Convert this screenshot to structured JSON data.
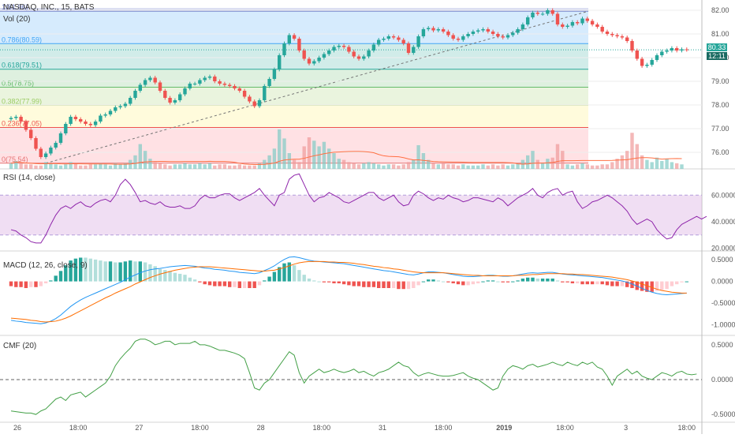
{
  "header": {
    "symbol": "NASDAQ, INC., 15, BATS",
    "volume_label": "Vol (20)",
    "rsi_label": "RSI (14, close)",
    "macd_label": "MACD (12, 26, close, 9)",
    "cmf_label": "CMF (20)"
  },
  "price_tags": {
    "last": "80.33",
    "countdown": "12:11"
  },
  "colors": {
    "up": "#26a69a",
    "down": "#ef5350",
    "rsi": "#8e24aa",
    "macd": "#2196f3",
    "signal": "#ff6d00",
    "cmf": "#43a047"
  },
  "chart_data": [
    {
      "type": "candlestick",
      "title": "NASDAQ, INC., 15, BATS",
      "ylim": [
        75.3,
        82.1
      ],
      "y_ticks": [
        "82.00",
        "81.00",
        "80.00",
        "79.00",
        "78.00",
        "77.00",
        "76.00"
      ],
      "x_ticks": [
        "26",
        "18:00",
        "27",
        "18:00",
        "28",
        "18:00",
        "31",
        "18:00",
        "2019",
        "18:00",
        "3",
        "18:00"
      ],
      "fib_levels": [
        {
          "label": "0(75.54)",
          "value": 75.54
        },
        {
          "label": "0.236(77.05)",
          "value": 77.05
        },
        {
          "label": "0.382(77.99)",
          "value": 77.99
        },
        {
          "label": "0.5(78.75)",
          "value": 78.75
        },
        {
          "label": "0.618(79.51)",
          "value": 79.51
        },
        {
          "label": "0.786(80.59)",
          "value": 80.59
        },
        {
          "label": "1(81.96)",
          "value": 81.96
        }
      ],
      "close": [
        77.45,
        77.5,
        77.3,
        76.95,
        76.6,
        76.15,
        75.8,
        75.95,
        76.2,
        76.4,
        76.8,
        77.2,
        77.5,
        77.4,
        77.3,
        77.2,
        77.15,
        77.3,
        77.55,
        77.6,
        77.75,
        77.9,
        77.95,
        78.05,
        78.3,
        78.6,
        78.85,
        79.05,
        79.15,
        78.95,
        78.6,
        78.3,
        78.1,
        78.2,
        78.45,
        78.7,
        78.9,
        78.9,
        79.05,
        79.15,
        79.2,
        79.0,
        78.9,
        78.85,
        78.8,
        78.7,
        78.6,
        78.35,
        78.15,
        77.95,
        78.2,
        78.8,
        79.1,
        79.5,
        80.1,
        80.6,
        80.95,
        80.8,
        80.3,
        79.95,
        79.75,
        79.85,
        80.0,
        80.15,
        80.3,
        80.45,
        80.5,
        80.45,
        80.25,
        80.05,
        79.95,
        80.05,
        80.3,
        80.55,
        80.75,
        80.8,
        80.9,
        80.85,
        80.75,
        80.6,
        80.2,
        80.45,
        80.9,
        81.2,
        81.25,
        81.15,
        81.2,
        81.1,
        80.95,
        80.8,
        80.75,
        80.9,
        81.0,
        81.1,
        81.15,
        81.2,
        81.1,
        81.0,
        80.9,
        80.85,
        80.95,
        81.05,
        81.2,
        81.4,
        81.7,
        81.9,
        81.85,
        81.85,
        82.0,
        81.85,
        81.4,
        81.3,
        81.35,
        81.5,
        81.45,
        81.65,
        81.55,
        81.4,
        81.3,
        81.1,
        81.0,
        80.95,
        80.9,
        80.85,
        80.7,
        80.3,
        79.95,
        79.65,
        79.7,
        79.9,
        80.1,
        80.25,
        80.3,
        80.4,
        80.3,
        80.35,
        80.33
      ]
    },
    {
      "type": "bar",
      "title": "Vol (20)",
      "values": [
        5,
        7,
        5,
        4,
        4,
        3,
        3,
        6,
        5,
        4,
        3,
        4,
        6,
        5,
        3,
        3,
        4,
        4,
        5,
        4,
        3,
        5,
        4,
        5,
        8,
        12,
        22,
        16,
        9,
        6,
        5,
        4,
        3,
        4,
        4,
        5,
        4,
        4,
        5,
        4,
        5,
        3,
        4,
        4,
        3,
        3,
        4,
        3,
        3,
        3,
        5,
        8,
        12,
        18,
        35,
        27,
        14,
        8,
        6,
        20,
        28,
        25,
        20,
        24,
        18,
        14,
        9,
        8,
        6,
        5,
        4,
        5,
        6,
        5,
        4,
        3,
        4,
        4,
        3,
        4,
        6,
        8,
        21,
        14,
        8,
        5,
        4,
        5,
        4,
        4,
        3,
        4,
        3,
        3,
        3,
        4,
        3,
        4,
        3,
        4,
        3,
        4,
        5,
        8,
        12,
        16,
        8,
        5,
        9,
        10,
        22,
        16,
        4,
        3,
        4,
        5,
        4,
        3,
        3,
        4,
        4,
        6,
        9,
        12,
        16,
        32,
        22,
        12,
        8,
        6,
        10,
        7,
        9,
        6,
        5,
        4
      ]
    },
    {
      "type": "line",
      "title": "RSI (14, close)",
      "ylim": [
        18,
        78
      ],
      "y_ticks": [
        "60.0000",
        "40.0000",
        "20.0000"
      ],
      "band": [
        30,
        60
      ],
      "values": [
        34,
        33,
        30,
        28,
        25,
        24,
        24,
        30,
        38,
        45,
        50,
        52,
        50,
        53,
        55,
        52,
        51,
        54,
        56,
        57,
        55,
        60,
        68,
        72,
        68,
        62,
        55,
        56,
        54,
        53,
        55,
        52,
        51,
        51,
        52,
        50,
        50,
        52,
        57,
        60,
        58,
        58,
        60,
        61,
        61,
        58,
        56,
        58,
        60,
        62,
        65,
        60,
        56,
        52,
        60,
        62,
        72,
        75,
        76,
        68,
        60,
        55,
        58,
        59,
        62,
        60,
        58,
        55,
        54,
        56,
        58,
        60,
        62,
        62,
        58,
        56,
        58,
        60,
        55,
        52,
        53,
        60,
        63,
        61,
        58,
        56,
        58,
        57,
        60,
        58,
        57,
        55,
        56,
        58,
        58,
        57,
        56,
        55,
        58,
        56,
        52,
        55,
        58,
        60,
        62,
        65,
        60,
        58,
        62,
        64,
        65,
        60,
        62,
        63,
        55,
        50,
        52,
        55,
        56,
        58,
        60,
        58,
        55,
        52,
        48,
        42,
        38,
        40,
        42,
        40,
        34,
        30,
        27,
        28,
        34,
        38,
        40,
        42,
        44,
        42,
        44
      ]
    },
    {
      "type": "line",
      "title": "MACD (12, 26, close, 9)",
      "ylim": [
        -1.25,
        0.65
      ],
      "y_ticks": [
        "0.5000",
        "0.0000",
        "-0.5000",
        "-1.0000"
      ],
      "series": [
        {
          "values": [
            -0.9,
            -0.92,
            -0.93,
            -0.95,
            -0.96,
            -0.97,
            -0.98,
            -0.96,
            -0.92,
            -0.86,
            -0.78,
            -0.68,
            -0.58,
            -0.5,
            -0.43,
            -0.37,
            -0.32,
            -0.27,
            -0.22,
            -0.17,
            -0.12,
            -0.07,
            -0.02,
            0.04,
            0.1,
            0.15,
            0.2,
            0.24,
            0.27,
            0.29,
            0.3,
            0.32,
            0.34,
            0.35,
            0.36,
            0.37,
            0.36,
            0.35,
            0.33,
            0.31,
            0.3,
            0.28,
            0.27,
            0.26,
            0.24,
            0.23,
            0.21,
            0.2,
            0.19,
            0.18,
            0.2,
            0.25,
            0.3,
            0.36,
            0.44,
            0.51,
            0.56,
            0.57,
            0.55,
            0.52,
            0.49,
            0.47,
            0.46,
            0.45,
            0.44,
            0.43,
            0.42,
            0.41,
            0.39,
            0.37,
            0.35,
            0.33,
            0.31,
            0.29,
            0.27,
            0.25,
            0.24,
            0.22,
            0.2,
            0.18,
            0.16,
            0.15,
            0.17,
            0.2,
            0.22,
            0.22,
            0.21,
            0.2,
            0.18,
            0.16,
            0.14,
            0.12,
            0.11,
            0.11,
            0.12,
            0.13,
            0.14,
            0.14,
            0.13,
            0.12,
            0.12,
            0.13,
            0.15,
            0.17,
            0.19,
            0.2,
            0.19,
            0.2,
            0.21,
            0.21,
            0.19,
            0.17,
            0.16,
            0.15,
            0.14,
            0.13,
            0.12,
            0.11,
            0.1,
            0.09,
            0.07,
            0.05,
            0.03,
            0.01,
            -0.02,
            -0.06,
            -0.11,
            -0.16,
            -0.21,
            -0.25,
            -0.28,
            -0.3,
            -0.31,
            -0.3,
            -0.29,
            -0.28,
            -0.27
          ]
        },
        {
          "values": [
            -0.85,
            -0.86,
            -0.87,
            -0.88,
            -0.9,
            -0.91,
            -0.93,
            -0.94,
            -0.93,
            -0.92,
            -0.89,
            -0.85,
            -0.8,
            -0.74,
            -0.68,
            -0.62,
            -0.56,
            -0.5,
            -0.44,
            -0.38,
            -0.33,
            -0.27,
            -0.22,
            -0.17,
            -0.12,
            -0.06,
            -0.01,
            0.04,
            0.09,
            0.13,
            0.17,
            0.2,
            0.23,
            0.26,
            0.28,
            0.3,
            0.32,
            0.33,
            0.34,
            0.34,
            0.34,
            0.33,
            0.32,
            0.31,
            0.3,
            0.29,
            0.28,
            0.27,
            0.26,
            0.25,
            0.24,
            0.24,
            0.25,
            0.26,
            0.29,
            0.32,
            0.36,
            0.4,
            0.43,
            0.45,
            0.46,
            0.46,
            0.46,
            0.46,
            0.45,
            0.45,
            0.44,
            0.44,
            0.43,
            0.42,
            0.4,
            0.39,
            0.37,
            0.35,
            0.34,
            0.32,
            0.31,
            0.29,
            0.28,
            0.26,
            0.24,
            0.22,
            0.21,
            0.2,
            0.2,
            0.2,
            0.2,
            0.2,
            0.19,
            0.18,
            0.17,
            0.16,
            0.15,
            0.14,
            0.14,
            0.13,
            0.13,
            0.13,
            0.13,
            0.13,
            0.13,
            0.13,
            0.14,
            0.14,
            0.15,
            0.16,
            0.16,
            0.17,
            0.18,
            0.18,
            0.18,
            0.18,
            0.17,
            0.17,
            0.16,
            0.16,
            0.15,
            0.14,
            0.13,
            0.12,
            0.11,
            0.1,
            0.08,
            0.06,
            0.04,
            0.01,
            -0.02,
            -0.06,
            -0.1,
            -0.14,
            -0.18,
            -0.21,
            -0.23,
            -0.25,
            -0.26,
            -0.27,
            -0.27
          ]
        }
      ]
    },
    {
      "type": "line",
      "title": "CMF (20)",
      "ylim": [
        -0.6,
        0.6
      ],
      "y_ticks": [
        "0.5000",
        "0.0000",
        "-0.5000"
      ],
      "baseline": 0,
      "values": [
        -0.45,
        -0.46,
        -0.47,
        -0.48,
        -0.48,
        -0.5,
        -0.45,
        -0.42,
        -0.35,
        -0.28,
        -0.25,
        -0.3,
        -0.22,
        -0.2,
        -0.18,
        -0.25,
        -0.2,
        -0.15,
        -0.1,
        -0.05,
        0.05,
        0.2,
        0.3,
        0.38,
        0.45,
        0.55,
        0.58,
        0.58,
        0.55,
        0.5,
        0.52,
        0.55,
        0.55,
        0.5,
        0.52,
        0.52,
        0.52,
        0.55,
        0.5,
        0.5,
        0.48,
        0.45,
        0.42,
        0.42,
        0.4,
        0.38,
        0.35,
        0.3,
        0.1,
        -0.12,
        -0.15,
        -0.05,
        0.0,
        0.1,
        0.2,
        0.3,
        0.4,
        0.35,
        0.1,
        -0.05,
        0.05,
        0.1,
        0.15,
        0.1,
        0.12,
        0.15,
        0.12,
        0.1,
        0.12,
        0.15,
        0.1,
        0.12,
        0.08,
        0.05,
        0.1,
        0.12,
        0.15,
        0.2,
        0.25,
        0.2,
        0.18,
        0.1,
        0.05,
        0.08,
        0.1,
        0.08,
        0.06,
        0.05,
        0.05,
        0.06,
        0.08,
        0.1,
        0.05,
        0.02,
        0.0,
        -0.05,
        -0.1,
        -0.15,
        -0.12,
        0.05,
        0.15,
        0.2,
        0.18,
        0.15,
        0.2,
        0.22,
        0.18,
        0.2,
        0.22,
        0.25,
        0.22,
        0.2,
        0.25,
        0.22,
        0.2,
        0.25,
        0.22,
        0.25,
        0.18,
        0.15,
        0.05,
        -0.08,
        0.05,
        0.1,
        0.15,
        0.08,
        0.12,
        0.05,
        0.02,
        0.0,
        0.05,
        0.1,
        0.08,
        0.05,
        0.1,
        0.12,
        0.08,
        0.07,
        0.08
      ]
    }
  ]
}
